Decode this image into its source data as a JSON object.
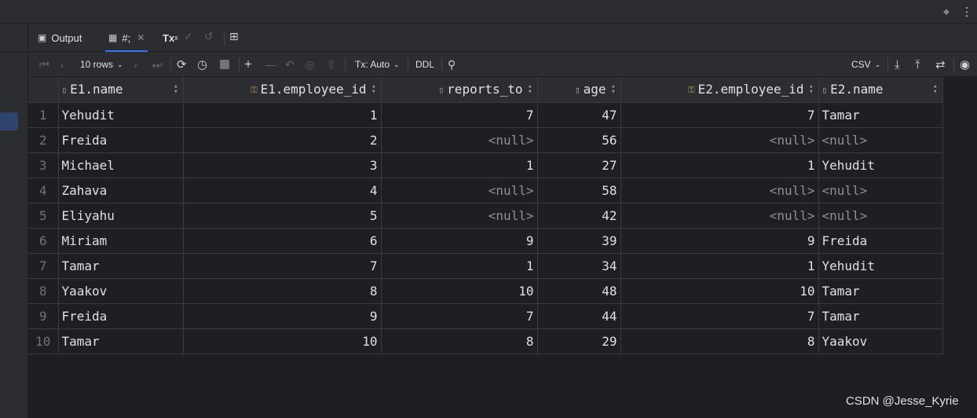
{
  "top_icons": [
    "crosshair-icon",
    "more-vertical-icon"
  ],
  "tabs": [
    {
      "label": "Output",
      "icon": "console-icon"
    },
    {
      "label": "#;",
      "icon": "table-icon",
      "active": true
    },
    {
      "label": "Tx",
      "icon": "transaction-icon"
    }
  ],
  "toolbar": {
    "rows_label": "10 rows",
    "tx_label": "Tx: Auto",
    "ddl_label": "DDL",
    "export_format": "CSV"
  },
  "columns": [
    {
      "name": "E1.name",
      "icon": "column-icon",
      "align": "left"
    },
    {
      "name": "E1.employee_id",
      "icon": "key-column-icon",
      "align": "right"
    },
    {
      "name": "reports_to",
      "icon": "column-icon",
      "align": "right"
    },
    {
      "name": "age",
      "icon": "column-icon",
      "align": "right"
    },
    {
      "name": "E2.employee_id",
      "icon": "key-column-icon",
      "align": "right"
    },
    {
      "name": "E2.name",
      "icon": "column-icon",
      "align": "left"
    }
  ],
  "rows": [
    {
      "n": "1",
      "c": [
        "Yehudit",
        "1",
        "7",
        "47",
        "7",
        "Tamar"
      ]
    },
    {
      "n": "2",
      "c": [
        "Freida",
        "2",
        "<null>",
        "56",
        "<null>",
        "<null>"
      ]
    },
    {
      "n": "3",
      "c": [
        "Michael",
        "3",
        "1",
        "27",
        "1",
        "Yehudit"
      ]
    },
    {
      "n": "4",
      "c": [
        "Zahava",
        "4",
        "<null>",
        "58",
        "<null>",
        "<null>"
      ]
    },
    {
      "n": "5",
      "c": [
        "Eliyahu",
        "5",
        "<null>",
        "42",
        "<null>",
        "<null>"
      ]
    },
    {
      "n": "6",
      "c": [
        "Miriam",
        "6",
        "9",
        "39",
        "9",
        "Freida"
      ]
    },
    {
      "n": "7",
      "c": [
        "Tamar",
        "7",
        "1",
        "34",
        "1",
        "Yehudit"
      ]
    },
    {
      "n": "8",
      "c": [
        "Yaakov",
        "8",
        "10",
        "48",
        "10",
        "Tamar"
      ]
    },
    {
      "n": "9",
      "c": [
        "Freida",
        "9",
        "7",
        "44",
        "7",
        "Tamar"
      ]
    },
    {
      "n": "10",
      "c": [
        "Tamar",
        "10",
        "8",
        "29",
        "8",
        "Yaakov"
      ]
    }
  ],
  "watermark": "CSDN @Jesse_Kyrie"
}
